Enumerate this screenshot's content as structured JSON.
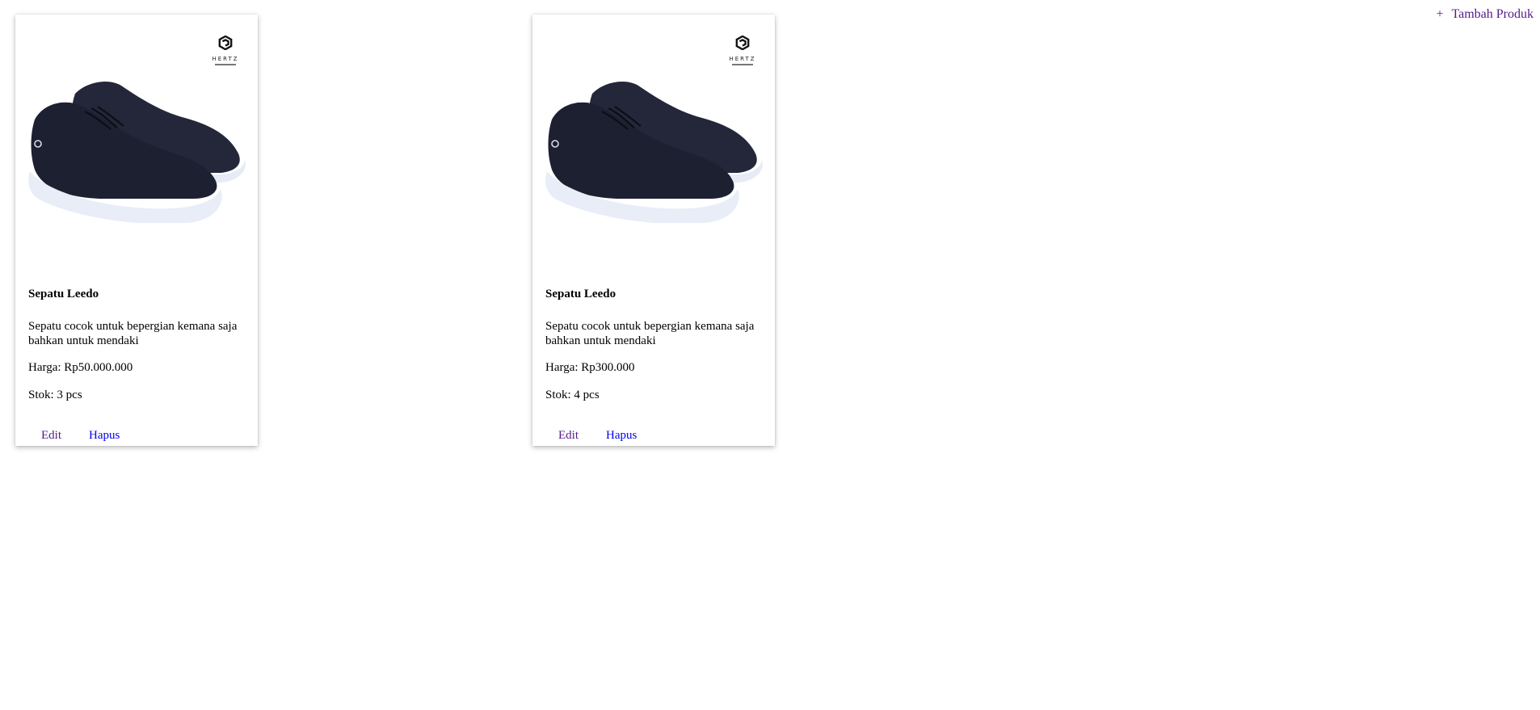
{
  "header": {
    "add_icon": "+",
    "add_label": "Tambah Produk"
  },
  "products": [
    {
      "name": "Sepatu Leedo",
      "description": "Sepatu cocok untuk bepergian kemana saja bahkan untuk mendaki",
      "price": "Harga: Rp50.000.000",
      "stock": "Stok: 3 pcs",
      "edit_label": "Edit",
      "delete_label": "Hapus",
      "brand": "HERTZ"
    },
    {
      "name": "Sepatu Leedo",
      "description": "Sepatu cocok untuk bepergian kemana saja bahkan untuk mendaki",
      "price": "Harga: Rp300.000",
      "stock": "Stok: 4 pcs",
      "edit_label": "Edit",
      "delete_label": "Hapus",
      "brand": "HERTZ"
    }
  ],
  "colors": {
    "visited_link": "#551a8b",
    "link": "#0000ee",
    "shoe_upper": "#1d2030",
    "shoe_sole": "#e9edf8"
  }
}
